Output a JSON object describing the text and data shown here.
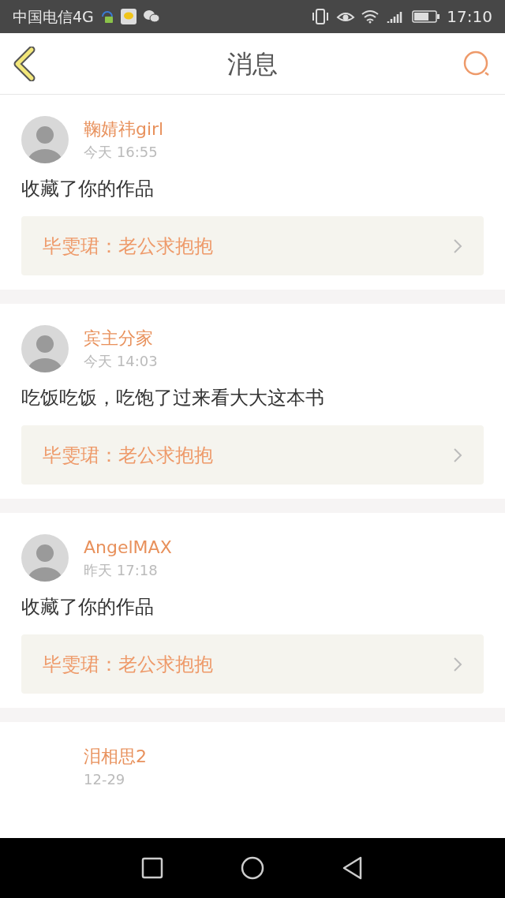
{
  "status_bar": {
    "carrier": "中国电信4G",
    "time": "17:10"
  },
  "header": {
    "title": "消息"
  },
  "messages": [
    {
      "name": "鞠婧祎girl",
      "time": "今天 16:55",
      "text": "收藏了你的作品",
      "quote": "毕雯珺：老公求抱抱",
      "avatar": true
    },
    {
      "name": "宾主分家",
      "time": "今天 14:03",
      "text": "吃饭吃饭，吃饱了过来看大大这本书",
      "quote": "毕雯珺：老公求抱抱",
      "avatar": true
    },
    {
      "name": "AngelMAX",
      "time": "昨天 17:18",
      "text": "收藏了你的作品",
      "quote": "毕雯珺：老公求抱抱",
      "avatar": true
    },
    {
      "name": "泪相思2",
      "time": "12-29",
      "avatar": false
    }
  ]
}
